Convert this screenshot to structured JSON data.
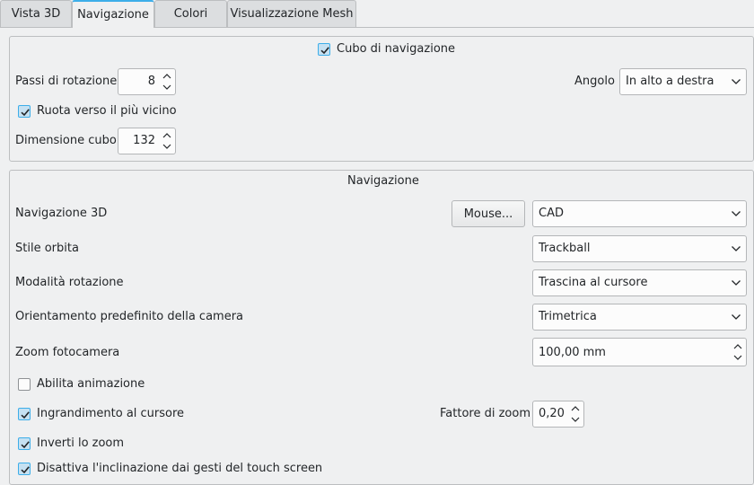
{
  "tabs": [
    "Vista 3D",
    "Navigazione",
    "Colori",
    "Visualizzazione Mesh"
  ],
  "active_tab": "Navigazione",
  "accent_color": "#3daee9",
  "navcube": {
    "enable_label": "Cubo di navigazione",
    "enabled": true,
    "rotation_steps_label": "Passi di rotazione",
    "rotation_steps_value": "8",
    "corner_label": "Angolo",
    "corner_value": "In alto a destra",
    "rotate_nearest_label": "Ruota verso il più vicino",
    "rotate_nearest_checked": true,
    "cube_size_label": "Dimensione cubo",
    "cube_size_value": "132"
  },
  "navigation": {
    "group_title": "Navigazione",
    "nav3d_label": "Navigazione 3D",
    "mouse_button": "Mouse...",
    "nav3d_value": "CAD",
    "orbit_style_label": "Stile orbita",
    "orbit_style_value": "Trackball",
    "rotation_mode_label": "Modalità rotazione",
    "rotation_mode_value": "Trascina al cursore",
    "camera_orientation_label": "Orientamento predefinito della camera",
    "camera_orientation_value": "Trimetrica",
    "camera_zoom_label": "Zoom fotocamera",
    "camera_zoom_value": "100,00 mm",
    "enable_animation_label": "Abilita animazione",
    "enable_animation_checked": false,
    "zoom_at_cursor_label": "Ingrandimento al cursore",
    "zoom_at_cursor_checked": true,
    "zoom_factor_label": "Fattore di zoom",
    "zoom_factor_value": "0,20",
    "invert_zoom_label": "Inverti lo zoom",
    "invert_zoom_checked": true,
    "disable_tilt_label": "Disattiva l'inclinazione dai gesti del touch screen",
    "disable_tilt_checked": true
  }
}
